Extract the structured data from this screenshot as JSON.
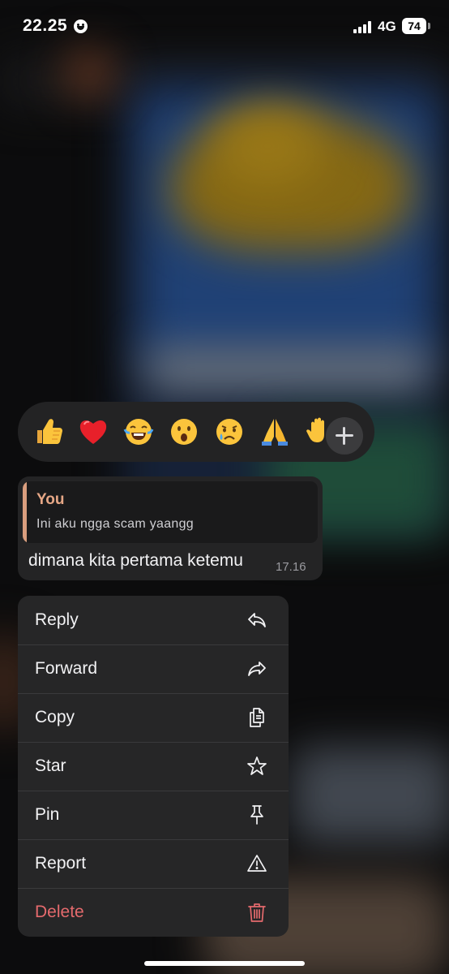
{
  "status_bar": {
    "time": "22.25",
    "network": "4G",
    "battery": "74"
  },
  "reactions": {
    "items": [
      {
        "name": "thumbs-up",
        "glyph": "👍"
      },
      {
        "name": "heart",
        "glyph": "❤"
      },
      {
        "name": "joy",
        "glyph": "😂"
      },
      {
        "name": "astonished",
        "glyph": "😮"
      },
      {
        "name": "crying",
        "glyph": "😢"
      },
      {
        "name": "folded-hands",
        "glyph": "🙏"
      },
      {
        "name": "raised-hand",
        "glyph": "✋"
      }
    ],
    "more_icon": "plus-icon"
  },
  "message": {
    "quote_author": "You",
    "quote_text": "Ini aku ngga scam yaangg",
    "text": "dimana kita pertama ketemu",
    "time": "17.16"
  },
  "menu": {
    "items": [
      {
        "label": "Reply",
        "icon": "reply-icon"
      },
      {
        "label": "Forward",
        "icon": "forward-icon"
      },
      {
        "label": "Copy",
        "icon": "copy-icon"
      },
      {
        "label": "Star",
        "icon": "star-icon"
      },
      {
        "label": "Pin",
        "icon": "pin-icon"
      },
      {
        "label": "Report",
        "icon": "warning-icon"
      },
      {
        "label": "Delete",
        "icon": "trash-icon"
      }
    ]
  },
  "colors": {
    "quote_accent": "#d99e7e",
    "danger": "#e56a6d"
  }
}
